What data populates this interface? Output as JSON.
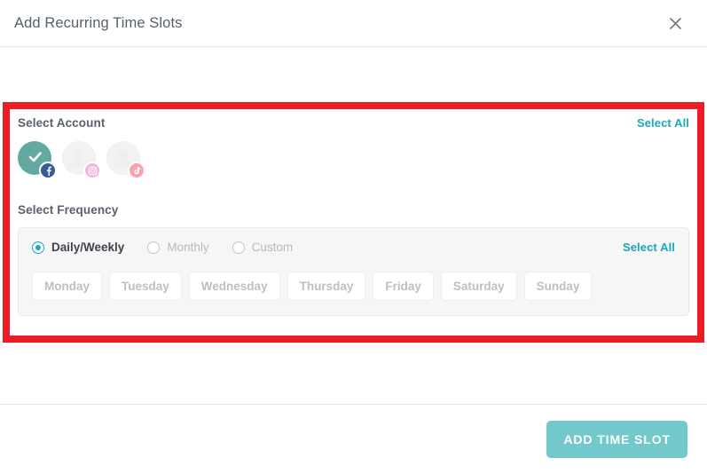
{
  "modal": {
    "title": "Add Recurring Time Slots",
    "close_icon": "close-icon"
  },
  "account_section": {
    "label": "Select Account",
    "select_all_label": "Select All",
    "accounts": [
      {
        "network": "facebook",
        "selected": true,
        "badge_icon": "facebook-icon",
        "state_icon": "check-icon"
      },
      {
        "network": "instagram",
        "selected": false,
        "badge_icon": "instagram-icon",
        "state_icon": ""
      },
      {
        "network": "tiktok",
        "selected": false,
        "badge_icon": "tiktok-icon",
        "state_icon": ""
      }
    ]
  },
  "frequency_section": {
    "label": "Select Frequency",
    "select_all_label": "Select All",
    "options": [
      {
        "label": "Daily/Weekly",
        "selected": true
      },
      {
        "label": "Monthly",
        "selected": false
      },
      {
        "label": "Custom",
        "selected": false
      }
    ],
    "days": [
      {
        "label": "Monday",
        "selected": false
      },
      {
        "label": "Tuesday",
        "selected": false
      },
      {
        "label": "Wednesday",
        "selected": false
      },
      {
        "label": "Thursday",
        "selected": false
      },
      {
        "label": "Friday",
        "selected": false
      },
      {
        "label": "Saturday",
        "selected": false
      },
      {
        "label": "Sunday",
        "selected": false
      }
    ]
  },
  "footer": {
    "primary_button_label": "ADD TIME SLOT"
  },
  "annotation": {
    "color": "#ed1c24"
  },
  "colors": {
    "accent": "#1aa8bd",
    "primary_button": "#72c8ca",
    "selected_avatar": "#63a9a2",
    "facebook": "#3b5a9a",
    "instagram": "#f3b7d6",
    "tiktok": "#f9a3ae"
  }
}
